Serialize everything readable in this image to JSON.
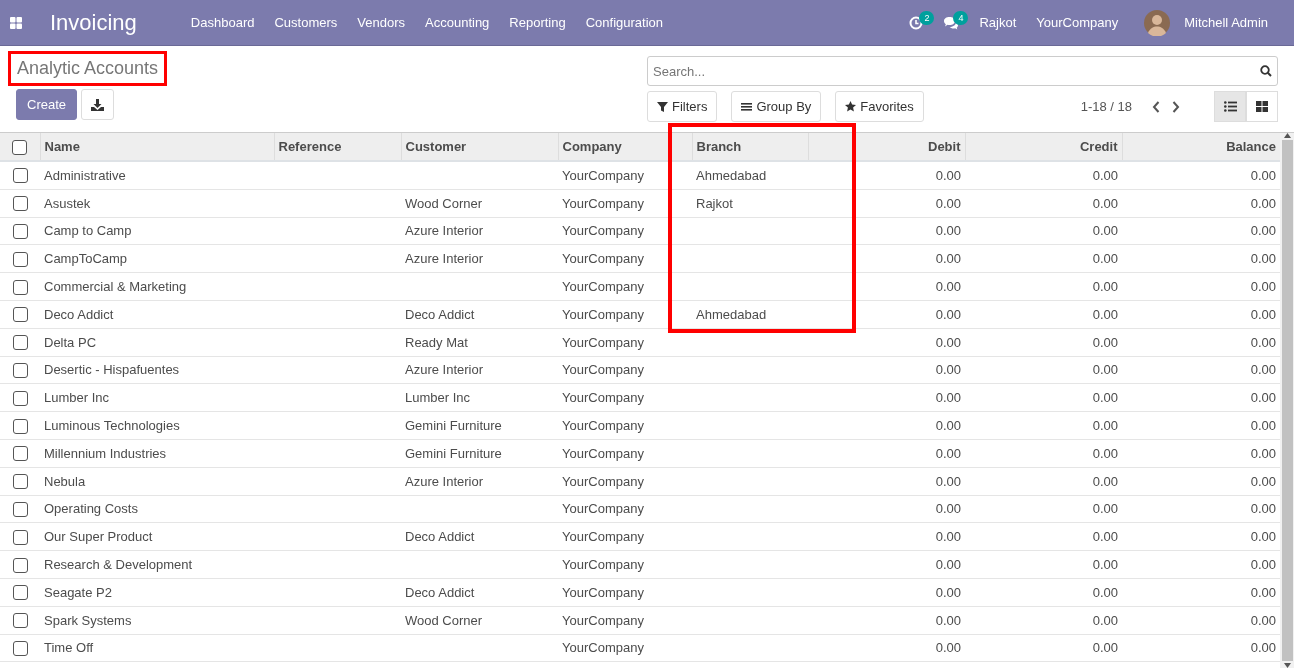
{
  "app": {
    "name": "Invoicing"
  },
  "menu": [
    "Dashboard",
    "Customers",
    "Vendors",
    "Accounting",
    "Reporting",
    "Configuration"
  ],
  "systray": {
    "activities_count": "2",
    "messages_count": "4",
    "branch": "Rajkot",
    "company": "YourCompany",
    "user": "Mitchell Admin"
  },
  "page_title": {
    "text": "Analytic Accounts",
    "highlighted": true
  },
  "create_button": "Create",
  "search": {
    "placeholder": "Search..."
  },
  "filter_buttons": [
    {
      "kind": "filter",
      "label": "Filters"
    },
    {
      "kind": "group",
      "label": "Group By"
    },
    {
      "kind": "favorite",
      "label": "Favorites"
    }
  ],
  "pager": "1-18 / 18",
  "views": [
    {
      "kind": "list",
      "selected": true
    },
    {
      "kind": "kanban",
      "selected": false
    }
  ],
  "table": {
    "select_all": {
      "checked": false
    },
    "columns": [
      {
        "label": "Name",
        "kind": "text",
        "highlighted": false
      },
      {
        "label": "Reference",
        "kind": "text",
        "highlighted": false
      },
      {
        "label": "Customer",
        "kind": "text",
        "highlighted": false
      },
      {
        "label": "Company",
        "kind": "text",
        "highlighted": false
      },
      {
        "label": "Branch",
        "kind": "text",
        "highlighted": true
      },
      {
        "label": "Debit",
        "kind": "amount",
        "highlighted": false
      },
      {
        "label": "Credit",
        "kind": "amount",
        "highlighted": false
      },
      {
        "label": "Balance",
        "kind": "amount",
        "highlighted": false
      }
    ],
    "rows": [
      {
        "selected": false,
        "cells": [
          "Administrative",
          "",
          "",
          "YourCompany",
          "Ahmedabad",
          "0.00",
          "0.00",
          "0.00"
        ]
      },
      {
        "selected": false,
        "cells": [
          "Asustek",
          "",
          "Wood Corner",
          "YourCompany",
          "Rajkot",
          "0.00",
          "0.00",
          "0.00"
        ]
      },
      {
        "selected": false,
        "cells": [
          "Camp to Camp",
          "",
          "Azure Interior",
          "YourCompany",
          "",
          "0.00",
          "0.00",
          "0.00"
        ]
      },
      {
        "selected": false,
        "cells": [
          "CampToCamp",
          "",
          "Azure Interior",
          "YourCompany",
          "",
          "0.00",
          "0.00",
          "0.00"
        ]
      },
      {
        "selected": false,
        "cells": [
          "Commercial & Marketing",
          "",
          "",
          "YourCompany",
          "",
          "0.00",
          "0.00",
          "0.00"
        ]
      },
      {
        "selected": false,
        "cells": [
          "Deco Addict",
          "",
          "Deco Addict",
          "YourCompany",
          "Ahmedabad",
          "0.00",
          "0.00",
          "0.00"
        ]
      },
      {
        "selected": false,
        "cells": [
          "Delta PC",
          "",
          "Ready Mat",
          "YourCompany",
          "",
          "0.00",
          "0.00",
          "0.00"
        ]
      },
      {
        "selected": false,
        "cells": [
          "Desertic - Hispafuentes",
          "",
          "Azure Interior",
          "YourCompany",
          "",
          "0.00",
          "0.00",
          "0.00"
        ]
      },
      {
        "selected": false,
        "cells": [
          "Lumber Inc",
          "",
          "Lumber Inc",
          "YourCompany",
          "",
          "0.00",
          "0.00",
          "0.00"
        ]
      },
      {
        "selected": false,
        "cells": [
          "Luminous Technologies",
          "",
          "Gemini Furniture",
          "YourCompany",
          "",
          "0.00",
          "0.00",
          "0.00"
        ]
      },
      {
        "selected": false,
        "cells": [
          "Millennium Industries",
          "",
          "Gemini Furniture",
          "YourCompany",
          "",
          "0.00",
          "0.00",
          "0.00"
        ]
      },
      {
        "selected": false,
        "cells": [
          "Nebula",
          "",
          "Azure Interior",
          "YourCompany",
          "",
          "0.00",
          "0.00",
          "0.00"
        ]
      },
      {
        "selected": false,
        "cells": [
          "Operating Costs",
          "",
          "",
          "YourCompany",
          "",
          "0.00",
          "0.00",
          "0.00"
        ]
      },
      {
        "selected": false,
        "cells": [
          "Our Super Product",
          "",
          "Deco Addict",
          "YourCompany",
          "",
          "0.00",
          "0.00",
          "0.00"
        ]
      },
      {
        "selected": false,
        "cells": [
          "Research & Development",
          "",
          "",
          "YourCompany",
          "",
          "0.00",
          "0.00",
          "0.00"
        ]
      },
      {
        "selected": false,
        "cells": [
          "Seagate P2",
          "",
          "Deco Addict",
          "YourCompany",
          "",
          "0.00",
          "0.00",
          "0.00"
        ]
      },
      {
        "selected": false,
        "cells": [
          "Spark Systems",
          "",
          "Wood Corner",
          "YourCompany",
          "",
          "0.00",
          "0.00",
          "0.00"
        ]
      },
      {
        "selected": false,
        "cells": [
          "Time Off",
          "",
          "",
          "YourCompany",
          "",
          "0.00",
          "0.00",
          "0.00"
        ]
      }
    ]
  }
}
